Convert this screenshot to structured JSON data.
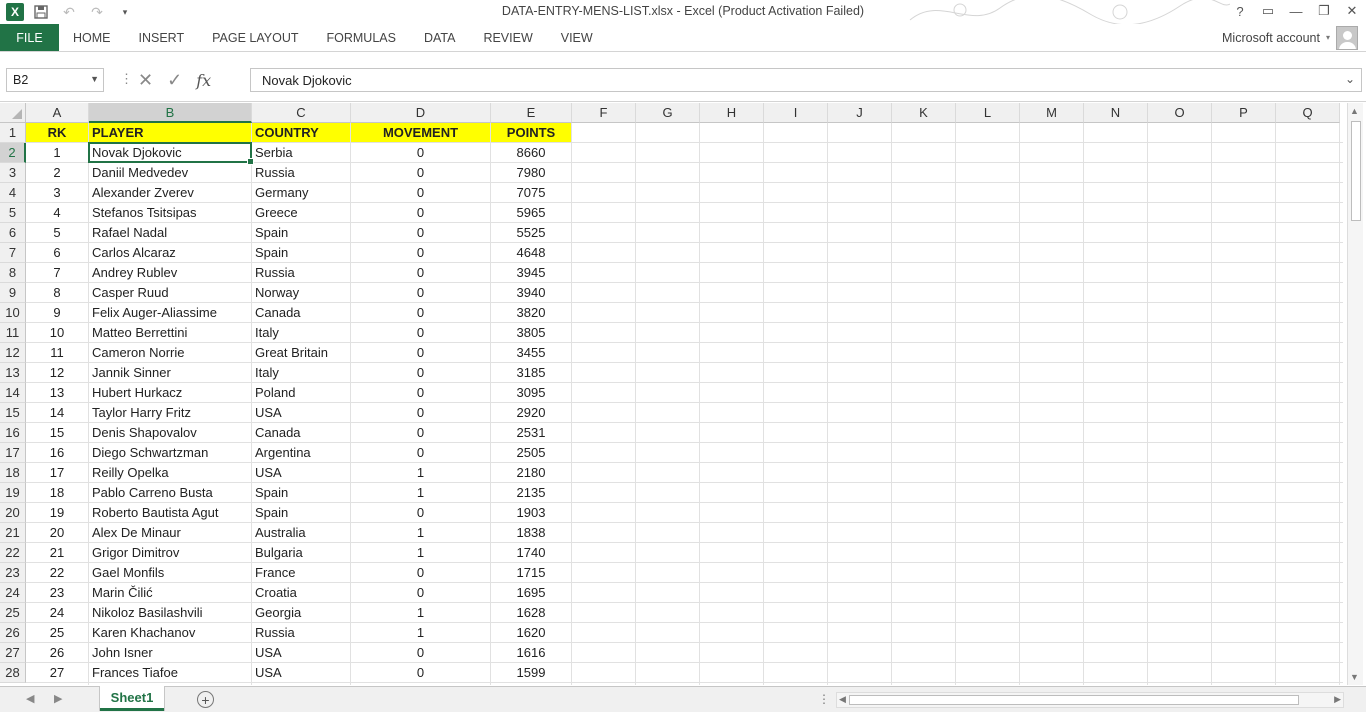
{
  "window": {
    "title": "DATA-ENTRY-MENS-LIST.xlsx - Excel (Product Activation Failed)",
    "logo": "X",
    "controls": [
      "?",
      "▭",
      "—",
      "❐",
      "✕"
    ]
  },
  "ribbon": {
    "file": "FILE",
    "tabs": [
      "HOME",
      "INSERT",
      "PAGE LAYOUT",
      "FORMULAS",
      "DATA",
      "REVIEW",
      "VIEW"
    ],
    "account": "Microsoft account"
  },
  "formula_bar": {
    "name_box": "B2",
    "cancel_icon": "✕",
    "enter_icon": "✓",
    "fx": "fx",
    "value": "Novak Djokovic"
  },
  "columns": [
    "A",
    "B",
    "C",
    "D",
    "E",
    "F",
    "G",
    "H",
    "I",
    "J",
    "K",
    "L",
    "M",
    "N",
    "O",
    "P",
    "Q"
  ],
  "rows": [
    "1",
    "2",
    "3",
    "4",
    "5",
    "6",
    "7",
    "8",
    "9",
    "10",
    "11",
    "12",
    "13",
    "14",
    "15",
    "16",
    "17",
    "18",
    "19",
    "20",
    "21",
    "22",
    "23",
    "24",
    "25",
    "26",
    "27",
    "28"
  ],
  "sheet": {
    "header": [
      "RK",
      "PLAYER",
      "COUNTRY",
      "MOVEMENT",
      "POINTS"
    ],
    "data": [
      [
        "1",
        "Novak Djokovic",
        "Serbia",
        "0",
        "8660"
      ],
      [
        "2",
        "Daniil Medvedev",
        "Russia",
        "0",
        "7980"
      ],
      [
        "3",
        "Alexander Zverev",
        "Germany",
        "0",
        "7075"
      ],
      [
        "4",
        "Stefanos Tsitsipas",
        "Greece",
        "0",
        "5965"
      ],
      [
        "5",
        "Rafael Nadal",
        "Spain",
        "0",
        "5525"
      ],
      [
        "6",
        "Carlos Alcaraz",
        "Spain",
        "0",
        "4648"
      ],
      [
        "7",
        "Andrey Rublev",
        "Russia",
        "0",
        "3945"
      ],
      [
        "8",
        "Casper Ruud",
        "Norway",
        "0",
        "3940"
      ],
      [
        "9",
        "Felix Auger-Aliassime",
        "Canada",
        "0",
        "3820"
      ],
      [
        "10",
        "Matteo Berrettini",
        "Italy",
        "0",
        "3805"
      ],
      [
        "11",
        "Cameron Norrie",
        "Great Britain",
        "0",
        "3455"
      ],
      [
        "12",
        "Jannik Sinner",
        "Italy",
        "0",
        "3185"
      ],
      [
        "13",
        "Hubert Hurkacz",
        "Poland",
        "0",
        "3095"
      ],
      [
        "14",
        "Taylor Harry Fritz",
        "USA",
        "0",
        "2920"
      ],
      [
        "15",
        "Denis Shapovalov",
        "Canada",
        "0",
        "2531"
      ],
      [
        "16",
        "Diego Schwartzman",
        "Argentina",
        "0",
        "2505"
      ],
      [
        "17",
        "Reilly Opelka",
        "USA",
        "1",
        "2180"
      ],
      [
        "18",
        "Pablo Carreno Busta",
        "Spain",
        "1",
        "2135"
      ],
      [
        "19",
        "Roberto Bautista Agut",
        "Spain",
        "0",
        "1903"
      ],
      [
        "20",
        "Alex De Minaur",
        "Australia",
        "1",
        "1838"
      ],
      [
        "21",
        "Grigor Dimitrov",
        "Bulgaria",
        "1",
        "1740"
      ],
      [
        "22",
        "Gael Monfils",
        "France",
        "0",
        "1715"
      ],
      [
        "23",
        "Marin Čilić",
        "Croatia",
        "0",
        "1695"
      ],
      [
        "24",
        "Nikoloz Basilashvili",
        "Georgia",
        "1",
        "1628"
      ],
      [
        "25",
        "Karen Khachanov",
        "Russia",
        "1",
        "1620"
      ],
      [
        "26",
        "John Isner",
        "USA",
        "0",
        "1616"
      ],
      [
        "27",
        "Frances Tiafoe",
        "USA",
        "0",
        "1599"
      ]
    ]
  },
  "sheet_tabs": {
    "active": "Sheet1"
  },
  "colors": {
    "accent": "#217346",
    "header_fill": "#ffff00"
  }
}
